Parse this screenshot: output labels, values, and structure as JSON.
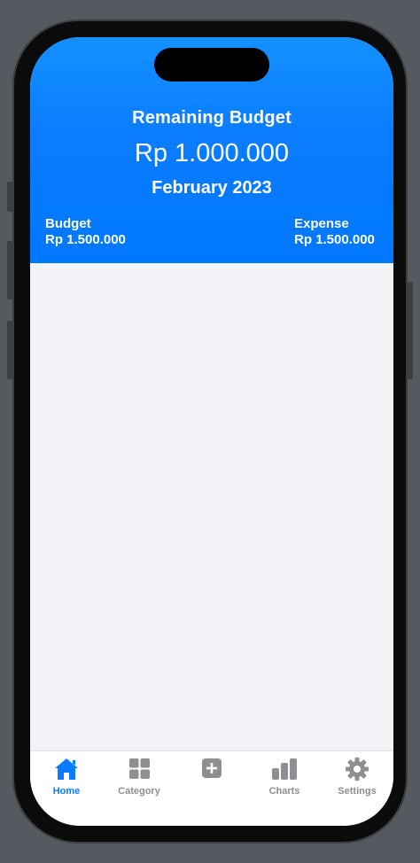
{
  "header": {
    "title": "Remaining Budget",
    "remaining_amount": "Rp 1.000.000",
    "period": "February 2023",
    "budget_label": "Budget",
    "budget_value": "Rp 1.500.000",
    "expense_label": "Expense",
    "expense_value": "Rp 1.500.000"
  },
  "tabbar": {
    "tabs": [
      {
        "label": "Home",
        "icon": "home-icon",
        "active": true
      },
      {
        "label": "Category",
        "icon": "grid-icon",
        "active": false
      },
      {
        "label": "",
        "icon": "plus-square-icon",
        "active": false
      },
      {
        "label": "Charts",
        "icon": "bar-chart-icon",
        "active": false
      },
      {
        "label": "Settings",
        "icon": "gear-icon",
        "active": false
      }
    ]
  },
  "colors": {
    "accent": "#0A7CFF",
    "header_bg": "#0078FE",
    "content_bg": "#F2F2F7",
    "inactive_tab": "#8E8E93"
  }
}
